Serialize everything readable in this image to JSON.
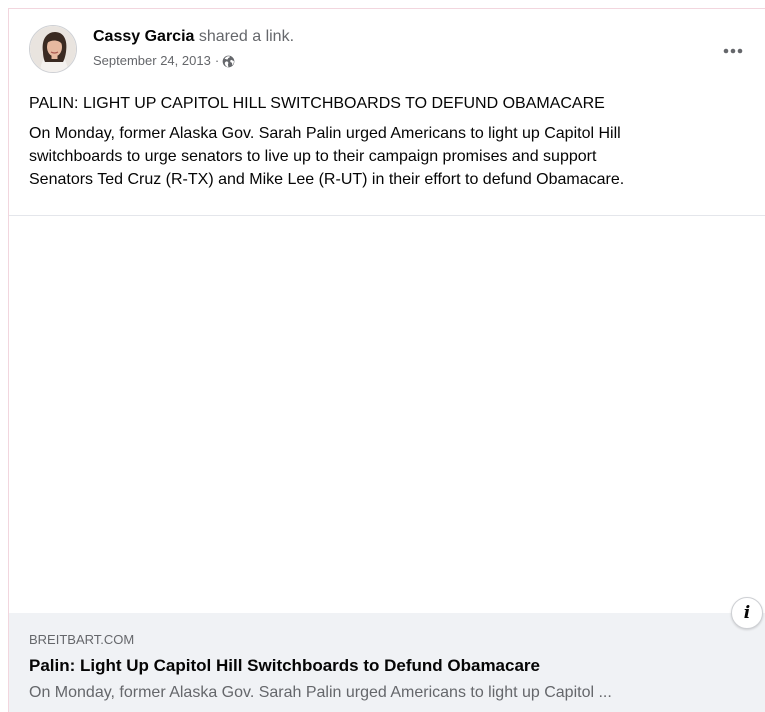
{
  "post": {
    "author": {
      "name": "Cassy Garcia",
      "action": "shared a link."
    },
    "timestamp": "September 24, 2013",
    "separator": "·",
    "audience_icon": "globe-icon",
    "more_icon": "more-horizontal-icon",
    "headline": "PALIN: LIGHT UP CAPITOL HILL SWITCHBOARDS TO DEFUND OBAMACARE",
    "body": "On Monday, former Alaska Gov. Sarah Palin urged Americans to light up Capitol Hill\nswitchboards to urge senators to live up to their campaign promises and support\nSenators Ted Cruz (R-TX) and Mike Lee (R-UT) in their effort to defund Obamacare."
  },
  "link_preview": {
    "domain": "BREITBART.COM",
    "title": "Palin: Light Up Capitol Hill Switchboards to Defund Obamacare",
    "description": "On Monday, former Alaska Gov. Sarah Palin urged Americans to light up Capitol ...",
    "info_glyph": "i"
  },
  "colors": {
    "primary_text": "#050505",
    "secondary_text": "#65676b",
    "footer_bg": "#f0f2f5",
    "divider": "#e4e6eb"
  }
}
